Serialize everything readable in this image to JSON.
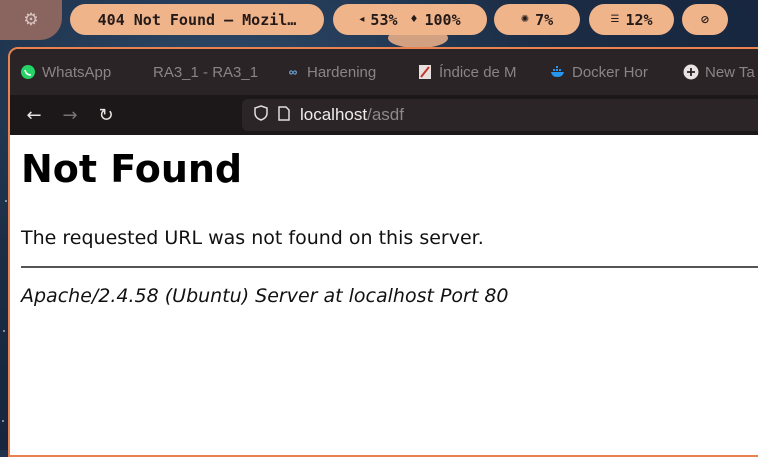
{
  "panel": {
    "window_title": "404 Not Found — Mozil…",
    "volume": "53%",
    "brightness": "100%",
    "cpu": "7%",
    "memory": "12%"
  },
  "tabs": [
    {
      "label": "WhatsApp",
      "icon": "whatsapp-icon",
      "color": "#25d366"
    },
    {
      "label": "RA3_1 - RA3_1",
      "icon": "none"
    },
    {
      "label": "Hardening",
      "icon": "meta-icon",
      "color": "#6fa8dc"
    },
    {
      "label": "Índice de M",
      "icon": "document-icon",
      "color": "#c0392b"
    },
    {
      "label": "Docker Hor",
      "icon": "docker-icon",
      "color": "#2496ed"
    },
    {
      "label": "New Ta",
      "icon": "plus-icon"
    }
  ],
  "address": {
    "host": "localhost",
    "path": "/asdf"
  },
  "page": {
    "heading": "Not Found",
    "message": "The requested URL was not found on this server.",
    "footer": "Apache/2.4.58 (Ubuntu) Server at localhost Port 80"
  },
  "colors": {
    "pill": "#f0b48a",
    "window_border": "#e8834f"
  }
}
